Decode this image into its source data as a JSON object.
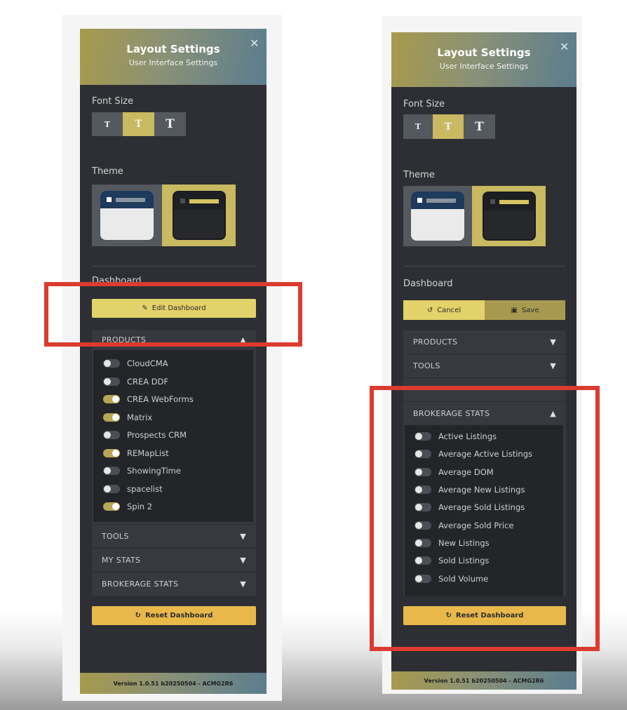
{
  "left_panel": {
    "header": {
      "title": "Layout Settings",
      "subtitle": "User Interface Settings"
    },
    "font_size": {
      "label": "Font Size",
      "options": [
        "T",
        "T",
        "T"
      ],
      "selected_index": 1
    },
    "theme": {
      "label": "Theme",
      "options": [
        "light",
        "dark"
      ],
      "selected": "dark"
    },
    "dashboard": {
      "label": "Dashboard",
      "edit_button": "Edit Dashboard"
    },
    "products": {
      "header": "PRODUCTS",
      "items": [
        {
          "label": "CloudCMA",
          "on": false
        },
        {
          "label": "CREA DDF",
          "on": false
        },
        {
          "label": "CREA WebForms",
          "on": true
        },
        {
          "label": "Matrix",
          "on": true
        },
        {
          "label": "Prospects CRM",
          "on": false
        },
        {
          "label": "REMapList",
          "on": true
        },
        {
          "label": "ShowingTime",
          "on": false
        },
        {
          "label": "spacelist",
          "on": false
        },
        {
          "label": "Spin 2",
          "on": true
        }
      ]
    },
    "sections": [
      "TOOLS",
      "MY STATS",
      "BROKERAGE STATS"
    ],
    "reset_button": "Reset Dashboard",
    "version": "Version 1.0.51 b20250504 - ACMG2R6"
  },
  "right_panel": {
    "header": {
      "title": "Layout Settings",
      "subtitle": "User Interface Settings"
    },
    "font_size": {
      "label": "Font Size",
      "options": [
        "T",
        "T",
        "T"
      ],
      "selected_index": 1
    },
    "theme": {
      "label": "Theme",
      "options": [
        "light",
        "dark"
      ],
      "selected": "dark"
    },
    "dashboard": {
      "label": "Dashboard",
      "cancel_button": "Cancel",
      "save_button": "Save"
    },
    "sections": [
      "PRODUCTS",
      "TOOLS"
    ],
    "brokerage_stats": {
      "header": "BROKERAGE STATS",
      "items": [
        {
          "label": "Active Listings",
          "on": false
        },
        {
          "label": "Average Active Listings",
          "on": false
        },
        {
          "label": "Average DOM",
          "on": false
        },
        {
          "label": "Average New Listings",
          "on": false
        },
        {
          "label": "Average Sold Listings",
          "on": false
        },
        {
          "label": "Average Sold Price",
          "on": false
        },
        {
          "label": "New Listings",
          "on": false
        },
        {
          "label": "Sold Listings",
          "on": false
        },
        {
          "label": "Sold Volume",
          "on": false
        }
      ]
    },
    "reset_button": "Reset Dashboard",
    "version": "Version 1.0.51 b20250504 - ACMG2R6"
  },
  "icons": {
    "close": "close-icon",
    "edit": "pencil-icon",
    "cancel": "undo-icon",
    "save": "save-icon",
    "reset": "refresh-icon",
    "chevron_down": "chevron-down-icon",
    "chevron_up": "chevron-up-icon"
  },
  "colors": {
    "accent_gold": "#e3d269",
    "reset_orange": "#e8b84b",
    "highlight_red": "#dc3b2f",
    "panel_bg": "#2d2f34"
  }
}
